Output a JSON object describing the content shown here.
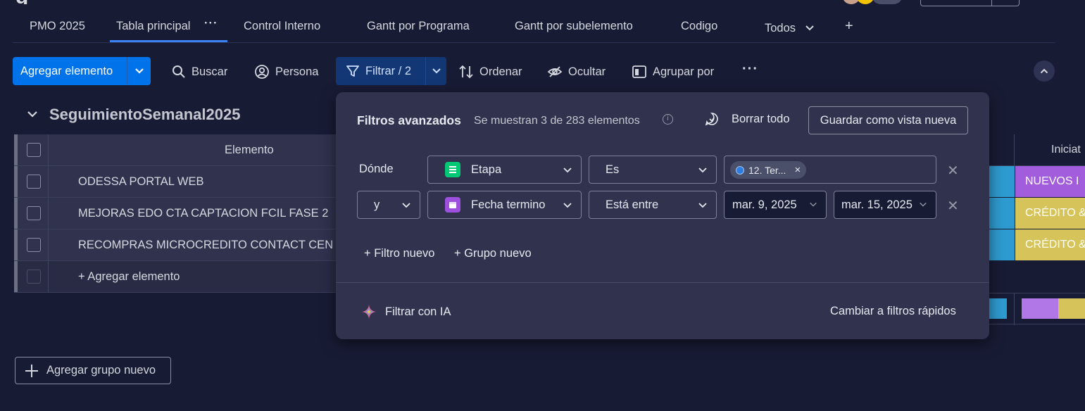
{
  "tabs": [
    {
      "label": "PMO 2025"
    },
    {
      "label": "Tabla principal",
      "more": "···"
    },
    {
      "label": "Control Interno"
    },
    {
      "label": "Gantt por Programa"
    },
    {
      "label": "Gantt por subelemento"
    },
    {
      "label": "Codigo"
    },
    {
      "label": "Todos"
    },
    {
      "label": "+"
    }
  ],
  "toolbar": {
    "add_item": "Agregar elemento",
    "search": "Buscar",
    "person": "Persona",
    "filter": "Filtrar / 2",
    "sort": "Ordenar",
    "hide": "Ocultar",
    "group_by": "Agrupar por",
    "more": "···"
  },
  "group": {
    "title": "SeguimientoSemanal2025",
    "column_header": "Elemento",
    "rows": [
      {
        "name": "ODESSA PORTAL WEB"
      },
      {
        "name": "MEJORAS EDO CTA CAPTACION FCIL FASE 2"
      },
      {
        "name": "RECOMPRAS MICROCREDITO CONTACT CEN"
      }
    ],
    "add_item": "+ Agregar elemento"
  },
  "right_columns": {
    "header": "Iniciat",
    "statuses": [
      "NUEVOS I",
      "CRÉDITO &",
      "CRÉDITO &"
    ],
    "colors": {
      "blue": "#2e9bd0",
      "purple": "#a25ddc",
      "yellow": "#d6c45a",
      "light_purple": "#b277e6"
    }
  },
  "add_group": "Agregar grupo nuevo",
  "filter_panel": {
    "title": "Filtros avanzados",
    "subtitle": "Se muestran 3 de 283 elementos",
    "info": "i",
    "clear_all": "Borrar todo",
    "save_view": "Guardar como vista nueva",
    "where_label": "Dónde",
    "row1": {
      "column": "Etapa",
      "column_icon": "table-icon",
      "column_color": "#00c875",
      "condition": "Es",
      "chip": "12. Ter...",
      "chip_remove": "×",
      "remove": "✕"
    },
    "row2": {
      "conjunction": "y",
      "column": "Fecha termino",
      "column_icon": "calendar-icon",
      "column_color": "#9d50dd",
      "condition": "Está entre",
      "date_from": "mar. 9, 2025",
      "date_to": "mar. 15, 2025",
      "remove": "✕"
    },
    "new_filter": "+ Filtro nuevo",
    "new_group": "+ Grupo nuevo",
    "ai_filter": "Filtrar con IA",
    "quick_filters": "Cambiar a filtros rápidos"
  }
}
